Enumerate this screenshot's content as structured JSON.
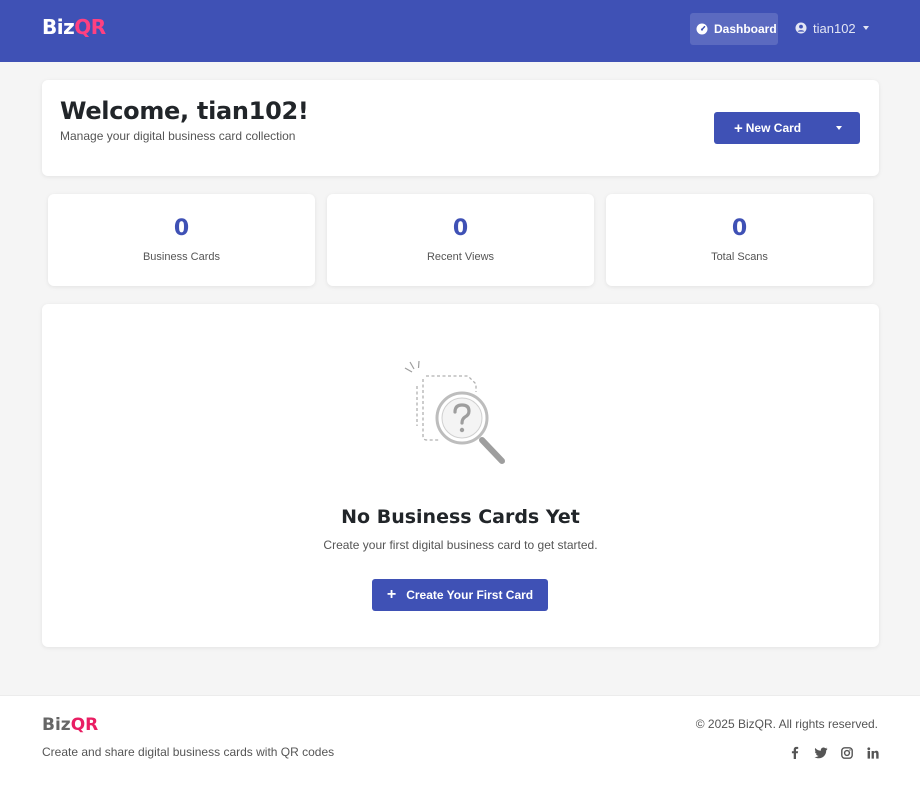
{
  "navbar": {
    "brand_part1": "Biz",
    "brand_part2": "QR",
    "dashboard_label": "Dashboard",
    "user_label": "tian102"
  },
  "welcome": {
    "title": "Welcome, tian102!",
    "subtitle": "Manage your digital business card collection",
    "new_card_label": "New Card"
  },
  "stats": [
    {
      "value": "0",
      "label": "Business Cards"
    },
    {
      "value": "0",
      "label": "Recent Views"
    },
    {
      "value": "0",
      "label": "Total Scans"
    }
  ],
  "empty_state": {
    "title": "No Business Cards Yet",
    "message": "Create your first digital business card to get started.",
    "button_label": "Create Your First Card"
  },
  "footer": {
    "brand_part1": "Biz",
    "brand_part2": "QR",
    "tagline": "Create and share digital business cards with QR codes",
    "copyright": "© 2025 BizQR. All rights reserved.",
    "social_icons": [
      "facebook-icon",
      "twitter-icon",
      "instagram-icon",
      "linkedin-icon"
    ]
  },
  "colors": {
    "primary": "#3f51b5",
    "accent": "#ff4081",
    "background": "#f5f5f5"
  }
}
